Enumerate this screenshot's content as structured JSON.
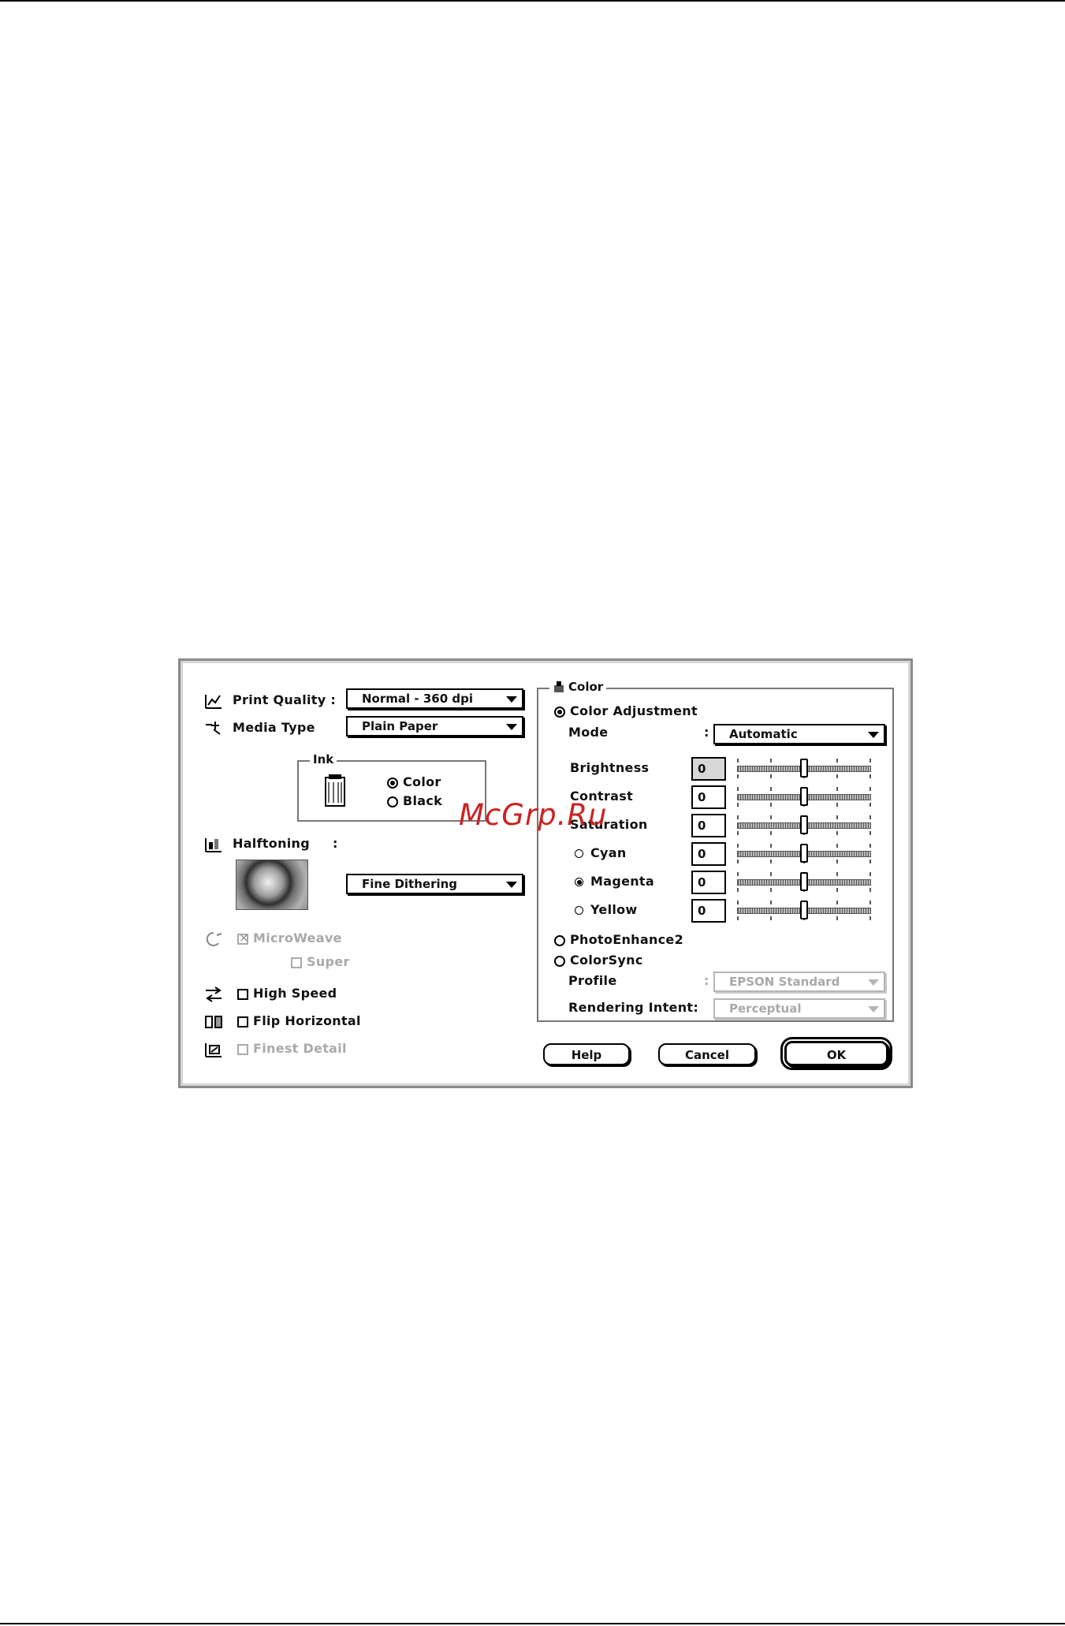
{
  "print_quality": {
    "label": "Print Quality :",
    "value": "Normal - 360 dpi"
  },
  "media_type": {
    "label": "Media Type",
    "value": "Plain Paper"
  },
  "ink": {
    "title": "Ink",
    "options": [
      "Color",
      "Black"
    ],
    "selected": "Color"
  },
  "halftoning": {
    "label": "Halftoning",
    "colon": ":",
    "value": "Fine Dithering"
  },
  "microweave": {
    "label": "MicroWeave",
    "checked": true,
    "enabled": false
  },
  "super": {
    "label": "Super",
    "checked": false,
    "enabled": false
  },
  "high_speed": {
    "label": "High Speed",
    "checked": false
  },
  "flip_horizontal": {
    "label": "Flip Horizontal",
    "checked": false
  },
  "finest_detail": {
    "label": "Finest Detail",
    "checked": false,
    "enabled": false
  },
  "color_group": {
    "title": "Color",
    "color_adjustment": {
      "label": "Color Adjustment",
      "selected": true
    },
    "mode": {
      "label": "Mode",
      "colon": ":",
      "value": "Automatic"
    },
    "sliders": [
      {
        "label": "Brightness",
        "value": "0",
        "level": 0
      },
      {
        "label": "Contrast",
        "value": "0",
        "level": 0
      },
      {
        "label": "Saturation",
        "value": "0",
        "level": 0
      },
      {
        "label": "Cyan",
        "value": "0",
        "level": 0
      },
      {
        "label": "Magenta",
        "value": "0",
        "level": 0
      },
      {
        "label": "Yellow",
        "value": "0",
        "level": 0
      }
    ],
    "photoenhance": {
      "label": "PhotoEnhance2",
      "selected": false
    },
    "colorsync": {
      "label": "ColorSync",
      "selected": false
    },
    "profile": {
      "label": "Profile",
      "colon": ":",
      "value": "EPSON Standard"
    },
    "rendering_intent": {
      "label": "Rendering Intent:",
      "value": "Perceptual"
    }
  },
  "buttons": {
    "help": "Help",
    "cancel": "Cancel",
    "ok": "OK"
  },
  "watermark": "McGrp.Ru"
}
